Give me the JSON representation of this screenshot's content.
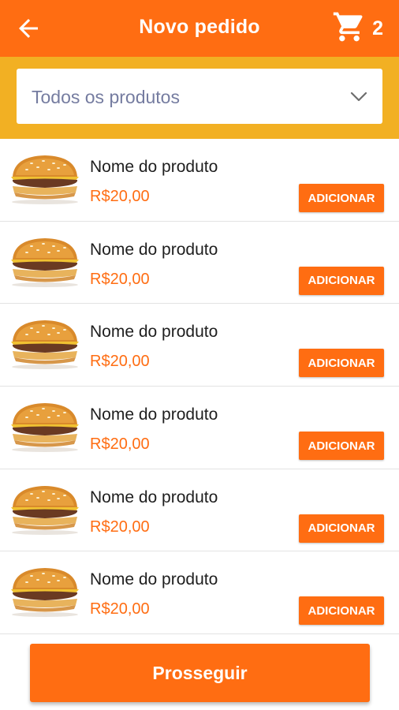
{
  "header": {
    "title": "Novo pedido",
    "cart_count": "2",
    "back_icon": "arrow-back-icon",
    "cart_icon": "shopping-cart-icon"
  },
  "filter": {
    "selected": "Todos os produtos",
    "icon": "chevron-down-icon"
  },
  "products": [
    {
      "name": "Nome do produto",
      "price": "R$20,00",
      "action": "ADICIONAR"
    },
    {
      "name": "Nome do produto",
      "price": "R$20,00",
      "action": "ADICIONAR"
    },
    {
      "name": "Nome do produto",
      "price": "R$20,00",
      "action": "ADICIONAR"
    },
    {
      "name": "Nome do produto",
      "price": "R$20,00",
      "action": "ADICIONAR"
    },
    {
      "name": "Nome do produto",
      "price": "R$20,00",
      "action": "ADICIONAR"
    },
    {
      "name": "Nome do produto",
      "price": "R$20,00",
      "action": "ADICIONAR"
    }
  ],
  "footer": {
    "proceed_label": "Prosseguir"
  },
  "colors": {
    "primary": "#FF6D12",
    "filter_band": "#F2B023",
    "placeholder_text": "#757CA0"
  }
}
